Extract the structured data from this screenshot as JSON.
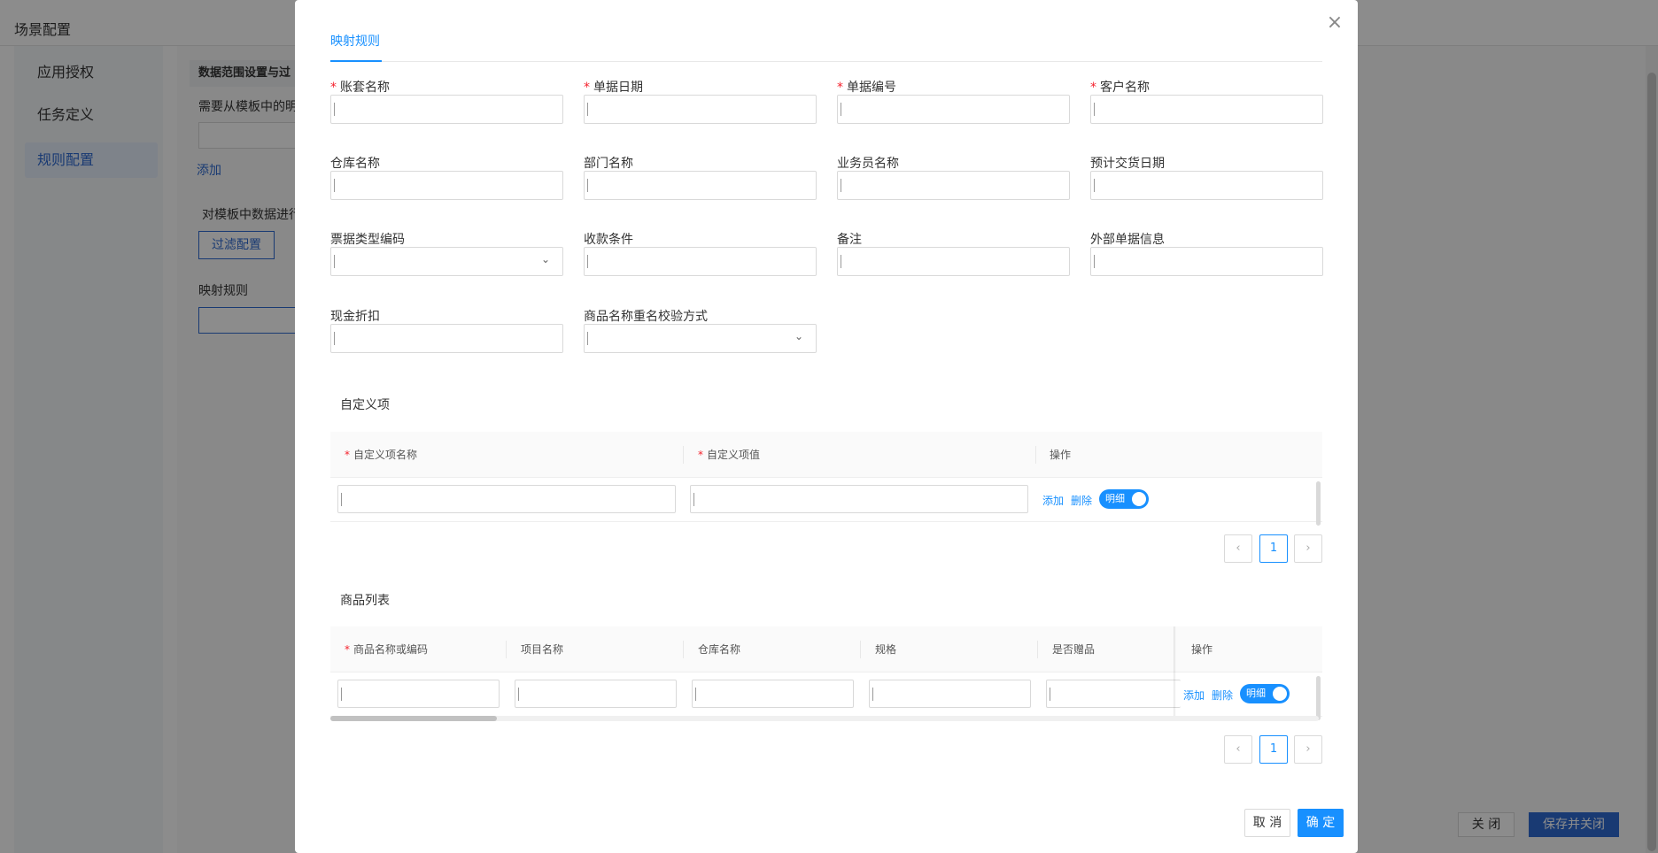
{
  "background": {
    "page_title": "场景配置",
    "sidebar": [
      {
        "label": "应用授权",
        "active": false
      },
      {
        "label": "任务定义",
        "active": false
      },
      {
        "label": "规则配置",
        "active": true
      }
    ],
    "tab_header": "数据范围设置与过",
    "template_label": "需要从模板中的明",
    "add_link": "添加",
    "filter_desc": "对模板中数据进行",
    "filter_button": "过滤配置",
    "mapping_label": "映射规则",
    "close_button": "关 闭",
    "save_close_button": "保存并关闭"
  },
  "modal": {
    "close_symbol": "×",
    "tab": "映射规则",
    "fields": [
      {
        "label": "账套名称",
        "required": true,
        "type": "input",
        "value": ""
      },
      {
        "label": "单据日期",
        "required": true,
        "type": "input",
        "value": ""
      },
      {
        "label": "单据编号",
        "required": true,
        "type": "input",
        "value": ""
      },
      {
        "label": "客户名称",
        "required": true,
        "type": "input",
        "value": ""
      },
      {
        "label": "仓库名称",
        "required": false,
        "type": "input",
        "value": ""
      },
      {
        "label": "部门名称",
        "required": false,
        "type": "input",
        "value": ""
      },
      {
        "label": "业务员名称",
        "required": false,
        "type": "input",
        "value": ""
      },
      {
        "label": "预计交货日期",
        "required": false,
        "type": "input",
        "value": ""
      },
      {
        "label": "票据类型编码",
        "required": false,
        "type": "select",
        "value": ""
      },
      {
        "label": "收款条件",
        "required": false,
        "type": "input",
        "value": ""
      },
      {
        "label": "备注",
        "required": false,
        "type": "input",
        "value": ""
      },
      {
        "label": "外部单据信息",
        "required": false,
        "type": "input",
        "value": ""
      },
      {
        "label": "现金折扣",
        "required": false,
        "type": "input",
        "value": ""
      },
      {
        "label": "商品名称重名校验方式",
        "required": false,
        "type": "select",
        "value": ""
      }
    ],
    "custom_section": {
      "title": "自定义项",
      "columns": [
        {
          "label": "自定义项名称",
          "required": true
        },
        {
          "label": "自定义项值",
          "required": true
        },
        {
          "label": "操作",
          "required": false
        }
      ],
      "row": {
        "add": "添加",
        "delete": "删除",
        "toggle_label": "明细",
        "toggle_on": true
      },
      "page": "1"
    },
    "goods_section": {
      "title": "商品列表",
      "columns": [
        {
          "label": "商品名称或编码",
          "required": true
        },
        {
          "label": "项目名称",
          "required": false
        },
        {
          "label": "仓库名称",
          "required": false
        },
        {
          "label": "规格",
          "required": false
        },
        {
          "label": "是否赠品",
          "required": false
        },
        {
          "label": "操作",
          "required": false
        }
      ],
      "row": {
        "add": "添加",
        "delete": "删除",
        "toggle_label": "明细",
        "toggle_on": true
      },
      "page": "1"
    },
    "pager": {
      "prev": "‹",
      "next": "›"
    },
    "footer": {
      "cancel": "取 消",
      "ok": "确 定"
    }
  },
  "colors": {
    "primary": "#1890ff",
    "required": "#f5222d",
    "mask": "rgba(0,0,0,0.45)"
  }
}
